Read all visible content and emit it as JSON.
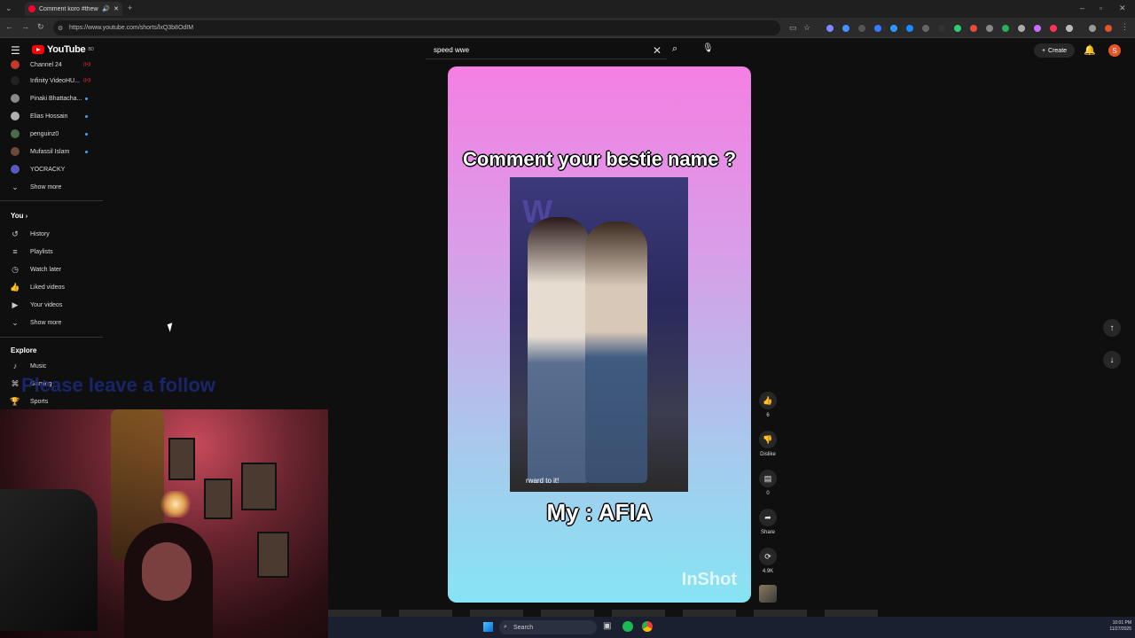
{
  "browser": {
    "tab_title": "Comment koro #theweekn",
    "url": "https://www.youtube.com/shorts/lxQ3b8OdIM"
  },
  "header": {
    "logo_text": "YouTube",
    "logo_region": "BD",
    "search_value": "speed wwe",
    "create_label": "Create",
    "avatar_letter": "S"
  },
  "sidebar": {
    "subscriptions": [
      {
        "label": "Channel 24",
        "badge": "live"
      },
      {
        "label": "Infinity VideoHU...",
        "badge": "live"
      },
      {
        "label": "Pinaki Bhattacha...",
        "badge": "dot"
      },
      {
        "label": "Elias Hossain",
        "badge": "dot"
      },
      {
        "label": "penguinz0",
        "badge": "dot"
      },
      {
        "label": "Mufassil Islam",
        "badge": "dot"
      },
      {
        "label": "YOCRACKY",
        "badge": ""
      }
    ],
    "show_more_1": "Show more",
    "you_label": "You",
    "you_items": [
      "History",
      "Playlists",
      "Watch later",
      "Liked videos",
      "Your videos"
    ],
    "show_more_2": "Show more",
    "explore_label": "Explore",
    "explore_items": [
      "Music",
      "Gaming",
      "Sports"
    ]
  },
  "overlay_text": "Please leave a follow",
  "short": {
    "caption_top": "Comment your bestie name ?",
    "caption_bottom": "My : AFIA",
    "inner_subtitle": "rward to it!",
    "watermark": "InShot",
    "like_count": "6",
    "dislike_label": "Dislike",
    "comment_count": "0",
    "share_label": "Share",
    "remix_count": "4.9K"
  },
  "taskbar": {
    "search_label": "Search",
    "time": "10:01 PM",
    "date": "11/27/2025"
  },
  "colors": {
    "yt_red": "#ff0000",
    "accent_blue": "#3ea6ff",
    "short_gradient_top": "#f47fe3",
    "short_gradient_bottom": "#86e4f3"
  }
}
